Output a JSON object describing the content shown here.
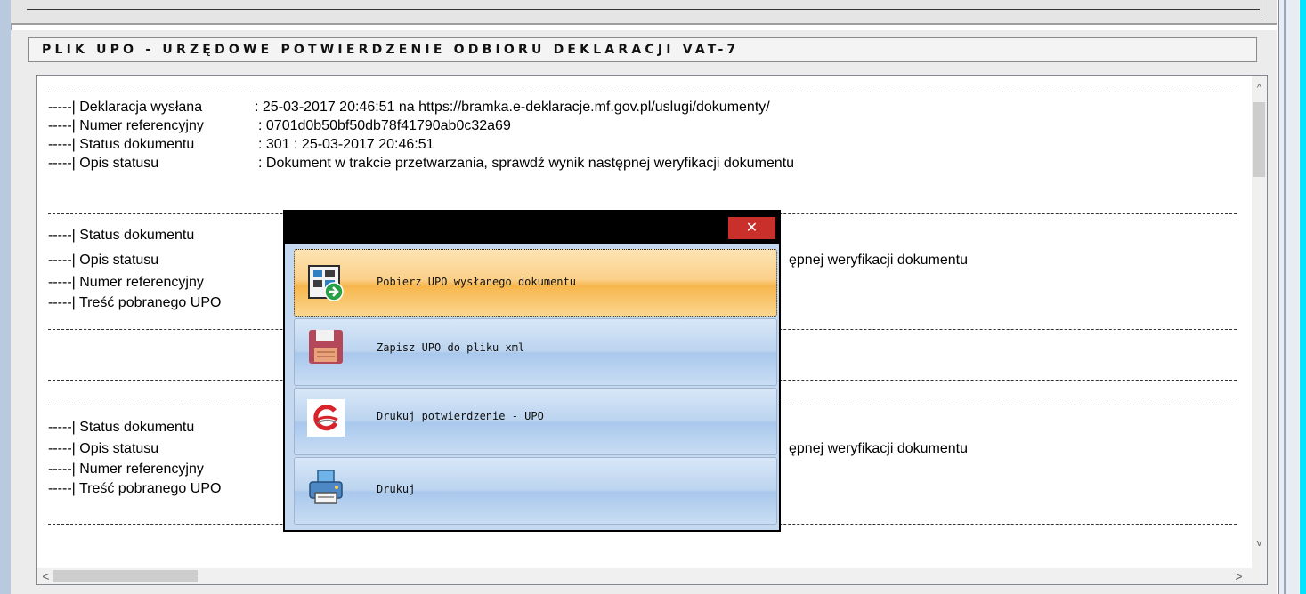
{
  "panel": {
    "title": "PLIK UPO - URZĘDOWE POTWIERDZENIE ODBIORU DEKLARACJI VAT-7"
  },
  "log": {
    "prefix": "-----|",
    "block1": {
      "sent_label": "Deklaracja wysłana",
      "sent_value": ": 25-03-2017 20:46:51 na https://bramka.e-deklaracje.mf.gov.pl/uslugi/dokumenty/",
      "ref_label": "Numer referencyjny",
      "ref_value": ":  0701d0b50bf50db78f41790ab0c32a69",
      "status_label": "Status dokumentu",
      "status_value": ":  301 :  25-03-2017 20:46:51",
      "desc_label": "Opis statusu",
      "desc_value": ":  Dokument w trakcie przetwarzania, sprawdź wynik następnej weryfikacji dokumentu"
    },
    "block2": {
      "status_label": "Status dokumentu",
      "desc_label": "Opis statusu",
      "desc_value_fragment": "ępnej weryfikacji dokumentu",
      "ref_label": "Numer referencyjny",
      "upo_label": "Treść pobranego UPO"
    },
    "block3": {
      "status_label": "Status dokumentu",
      "desc_label": "Opis statusu",
      "desc_value_fragment": "ępnej weryfikacji dokumentu",
      "ref_label": "Numer referencyjny",
      "upo_label": "Treść pobranego UPO"
    }
  },
  "popup": {
    "close_glyph": "✕",
    "items": [
      {
        "label": "Pobierz UPO wysłanego dokumentu",
        "icon": "download-upo-icon",
        "active": true
      },
      {
        "label": "Zapisz UPO do pliku xml",
        "icon": "floppy-disk-icon",
        "active": false
      },
      {
        "label": "Drukuj potwierdzenie - UPO",
        "icon": "red-logo-icon",
        "active": false
      },
      {
        "label": "Drukuj",
        "icon": "printer-icon",
        "active": false
      }
    ]
  },
  "scrollbars": {
    "up": "^",
    "down": "v",
    "left": "<",
    "right": ">"
  },
  "colors": {
    "active_item": "#f7b64c",
    "menu_item": "#bcd4ef",
    "close_button": "#c9302c",
    "edge_accent": "#00e5ff"
  }
}
